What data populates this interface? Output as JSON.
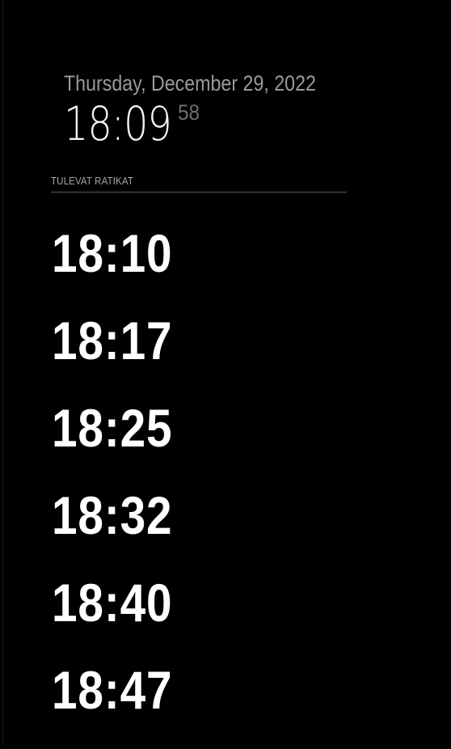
{
  "clock": {
    "date": "Thursday, December 29, 2022",
    "time": "18:09",
    "seconds": "58"
  },
  "departures_module": {
    "header": "TULEVAT RATIKAT",
    "items": [
      {
        "time": "18:10"
      },
      {
        "time": "18:17"
      },
      {
        "time": "18:25"
      },
      {
        "time": "18:32"
      },
      {
        "time": "18:40"
      },
      {
        "time": "18:47"
      }
    ]
  },
  "colors": {
    "background": "#000000",
    "primary_text": "#ffffff",
    "dim_text": "#9a9a9a",
    "seconds_text": "#6f6f6f",
    "divider": "#5a5a5a"
  }
}
